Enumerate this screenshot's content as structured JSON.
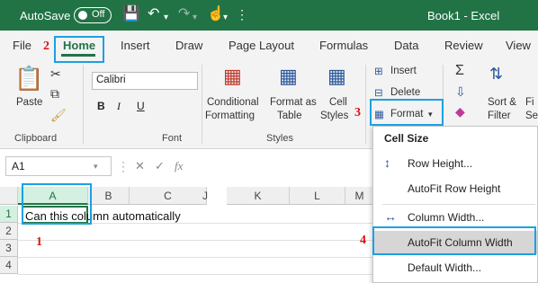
{
  "titlebar": {
    "autosave_label": "AutoSave",
    "toggle_state": "Off",
    "document_title": "Book1 - Excel"
  },
  "tabs": [
    {
      "label": "File"
    },
    {
      "label": "Home"
    },
    {
      "label": "Insert"
    },
    {
      "label": "Draw"
    },
    {
      "label": "Page Layout"
    },
    {
      "label": "Formulas"
    },
    {
      "label": "Data"
    },
    {
      "label": "Review"
    },
    {
      "label": "View"
    }
  ],
  "ribbon": {
    "clipboard": {
      "paste": "Paste",
      "label": "Clipboard"
    },
    "font": {
      "name": "Calibri",
      "label": "Font",
      "bold": "B",
      "italic": "I",
      "underline": "U"
    },
    "styles": {
      "conditional_1": "Conditional",
      "conditional_2": "Formatting",
      "format_table_1": "Format as",
      "format_table_2": "Table",
      "cell_styles_1": "Cell",
      "cell_styles_2": "Styles",
      "label": "Styles"
    },
    "cells": {
      "insert": "Insert",
      "delete": "Delete",
      "format": "Format"
    },
    "editing": {
      "sort_1": "Sort &",
      "sort_2": "Filter",
      "find_1": "Fi",
      "find_2": "Se"
    }
  },
  "formula_bar": {
    "name_box": "A1",
    "cancel": "✕",
    "enter": "✓",
    "fx": "fx"
  },
  "grid": {
    "columns": [
      "A",
      "B",
      "C",
      "J",
      "K",
      "L",
      "M"
    ],
    "rows": [
      "1",
      "2",
      "3",
      "4"
    ],
    "a1_text": "Can this column automatically"
  },
  "menu": {
    "heading": "Cell Size",
    "items": [
      {
        "label": "Row Height...",
        "icon": "row-height-icon"
      },
      {
        "label": "AutoFit Row Height",
        "icon": ""
      },
      {
        "label": "Column Width...",
        "icon": "column-width-icon"
      },
      {
        "label": "AutoFit Column Width",
        "icon": ""
      },
      {
        "label": "Default Width...",
        "icon": ""
      }
    ]
  },
  "steps": [
    "1",
    "2",
    "3",
    "4"
  ],
  "colors": {
    "excel_green": "#217346",
    "highlight_blue": "#1ba1e2",
    "step_red": "#dd1111"
  }
}
